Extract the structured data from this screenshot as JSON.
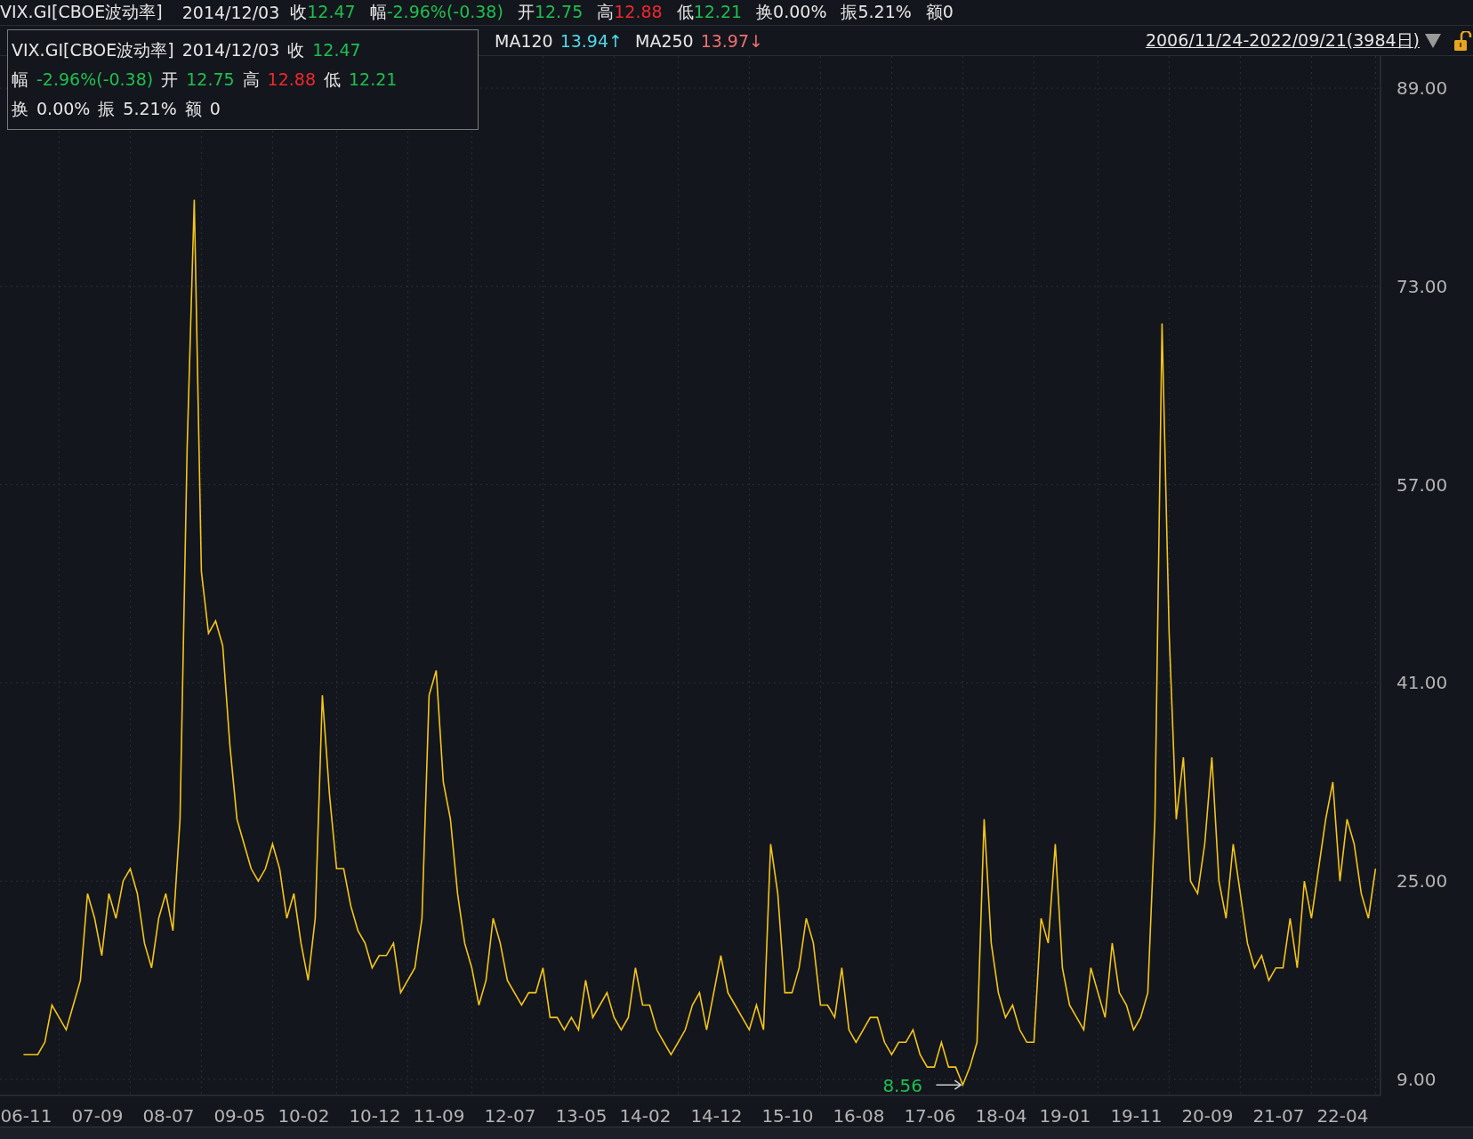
{
  "quote_bar": {
    "symbol": "VIX.GI[CBOE波动率]",
    "date": "2014/12/03",
    "fields": [
      {
        "label": "收",
        "value": "12.47",
        "color": "#1fbf4f"
      },
      {
        "label": "幅",
        "value": "-2.96%(-0.38)",
        "color": "#1fbf4f"
      },
      {
        "label": "开",
        "value": "12.75",
        "color": "#1fbf4f"
      },
      {
        "label": "高",
        "value": "12.88",
        "color": "#f0282d"
      },
      {
        "label": "低",
        "value": "12.21",
        "color": "#1fbf4f"
      },
      {
        "label": "换",
        "value": "0.00%",
        "color": "#e6e6e6"
      },
      {
        "label": "振",
        "value": "5.21%",
        "color": "#e6e6e6"
      },
      {
        "label": "额",
        "value": "0",
        "color": "#e6e6e6"
      }
    ]
  },
  "ma_bar": {
    "items": [
      {
        "label": "MA120",
        "value": "13.94↑",
        "color": "#4fd8e8"
      },
      {
        "label": "MA250",
        "value": "13.97↓",
        "color": "#f07070"
      }
    ],
    "range": "2006/11/24-2022/09/21(3984日)"
  },
  "tooltip": {
    "symbol": "VIX.GI[CBOE波动率]",
    "date": "2014/12/03",
    "fields": [
      {
        "label": "收",
        "value": "12.47",
        "color": "#1fbf4f"
      },
      {
        "label": "幅",
        "value": "-2.96%(-0.38)",
        "color": "#1fbf4f"
      },
      {
        "label": "开",
        "value": "12.75",
        "color": "#1fbf4f"
      },
      {
        "label": "高",
        "value": "12.88",
        "color": "#f0282d"
      },
      {
        "label": "低",
        "value": "12.21",
        "color": "#1fbf4f"
      },
      {
        "label": "换",
        "value": "0.00%",
        "color": "#e6e6e6"
      },
      {
        "label": "振",
        "value": "5.21%",
        "color": "#e6e6e6"
      },
      {
        "label": "额",
        "value": "0",
        "color": "#e6e6e6"
      }
    ]
  },
  "chart": {
    "chart_data": {
      "type": "line",
      "grid": true,
      "ylim": [
        7.71,
        91.59
      ],
      "yticks": [
        {
          "value": 9,
          "label": "9.00"
        },
        {
          "value": 25,
          "label": "25.00"
        },
        {
          "value": 41,
          "label": "41.00"
        },
        {
          "value": 57,
          "label": "57.00"
        },
        {
          "value": 73,
          "label": "73.00"
        },
        {
          "value": 89,
          "label": "89.00"
        }
      ],
      "categories": [
        "06-11",
        null,
        null,
        null,
        null,
        null,
        null,
        null,
        null,
        null,
        "07-09",
        null,
        null,
        null,
        null,
        null,
        null,
        null,
        null,
        null,
        "08-07",
        null,
        null,
        null,
        null,
        null,
        null,
        null,
        null,
        null,
        "09-05",
        null,
        null,
        null,
        null,
        null,
        null,
        null,
        null,
        "10-02",
        null,
        null,
        null,
        null,
        null,
        null,
        null,
        null,
        null,
        "10-12",
        null,
        null,
        null,
        null,
        null,
        null,
        null,
        null,
        "11-09",
        null,
        null,
        null,
        null,
        null,
        null,
        null,
        null,
        null,
        "12-07",
        null,
        null,
        null,
        null,
        null,
        null,
        null,
        null,
        null,
        "13-05",
        null,
        null,
        null,
        null,
        null,
        null,
        null,
        null,
        "14-02",
        null,
        null,
        null,
        null,
        null,
        null,
        null,
        null,
        null,
        "14-12",
        null,
        null,
        null,
        null,
        null,
        null,
        null,
        null,
        null,
        "15-10",
        null,
        null,
        null,
        null,
        null,
        null,
        null,
        null,
        null,
        "16-08",
        null,
        null,
        null,
        null,
        null,
        null,
        null,
        null,
        null,
        "17-06",
        null,
        null,
        null,
        null,
        null,
        null,
        null,
        null,
        null,
        "18-04",
        null,
        null,
        null,
        null,
        null,
        null,
        null,
        null,
        "19-01",
        null,
        null,
        null,
        null,
        null,
        null,
        null,
        null,
        null,
        "19-11",
        null,
        null,
        null,
        null,
        null,
        null,
        null,
        null,
        null,
        "20-09",
        null,
        null,
        null,
        null,
        null,
        null,
        null,
        null,
        null,
        "21-07",
        null,
        null,
        null,
        null,
        null,
        null,
        null,
        null,
        "22-04",
        null,
        null,
        null,
        null,
        null
      ],
      "series": [
        {
          "color": "#f5c518",
          "values": [
            11,
            11,
            11,
            12,
            15,
            14,
            13,
            15,
            17,
            24,
            22,
            19,
            24,
            22,
            25,
            26,
            24,
            20,
            18,
            22,
            24,
            21,
            30,
            60,
            80,
            50,
            45,
            46,
            44,
            36,
            30,
            28,
            26,
            25,
            26,
            28,
            26,
            22,
            24,
            20,
            17,
            22,
            40,
            32,
            26,
            26,
            23,
            21,
            20,
            18,
            19,
            19,
            20,
            16,
            17,
            18,
            22,
            40,
            42,
            33,
            30,
            24,
            20,
            18,
            15,
            17,
            22,
            20,
            17,
            16,
            15,
            16,
            16,
            18,
            14,
            14,
            13,
            14,
            13,
            17,
            14,
            15,
            16,
            14,
            13,
            14,
            18,
            15,
            15,
            13,
            12,
            11,
            12,
            13,
            15,
            16,
            13,
            16,
            19,
            16,
            15,
            14,
            13,
            15,
            13,
            28,
            24,
            16,
            16,
            18,
            22,
            20,
            15,
            15,
            14,
            18,
            13,
            12,
            13,
            14,
            14,
            12,
            11,
            12,
            12,
            13,
            11,
            10,
            10,
            12,
            10,
            10,
            8.56,
            10,
            12,
            30,
            20,
            16,
            14,
            15,
            13,
            12,
            12,
            22,
            20,
            28,
            18,
            15,
            14,
            13,
            18,
            16,
            14,
            20,
            16,
            15,
            13,
            14,
            16,
            30,
            70,
            45,
            30,
            35,
            25,
            24,
            28,
            35,
            25,
            22,
            28,
            24,
            20,
            18,
            19,
            17,
            18,
            18,
            22,
            18,
            25,
            22,
            26,
            30,
            33,
            25,
            30,
            28,
            24,
            22,
            26
          ]
        }
      ],
      "annotations": [
        "8.56"
      ]
    }
  }
}
